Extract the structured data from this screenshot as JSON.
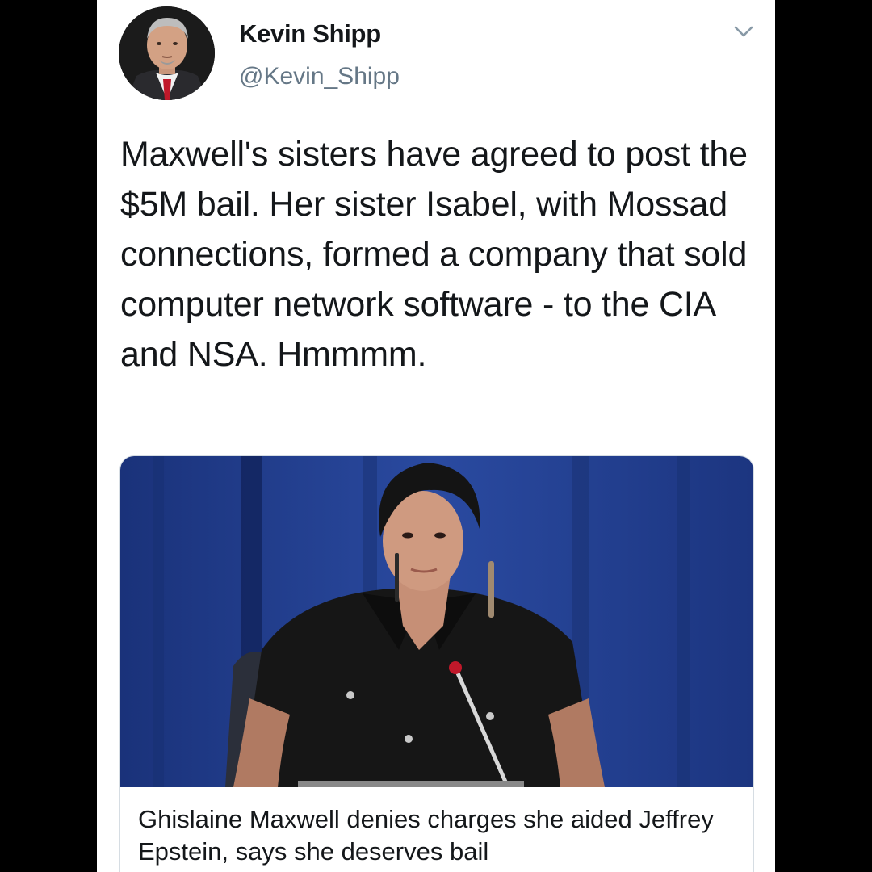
{
  "tweet": {
    "author_name": "Kevin Shipp",
    "author_handle": "@Kevin_Shipp",
    "text": "Maxwell's sisters have agreed to post the $5M bail. Her sister Isabel, with Mossad connections, formed a company that sold computer network software - to the CIA and NSA. Hmmmm.",
    "menu_icon": "chevron-down-icon"
  },
  "card": {
    "title": "Ghislaine Maxwell denies charges she aided Jeffrey Epstein, says she deserves bail"
  },
  "colors": {
    "background": "#000000",
    "tweet_background": "#ffffff",
    "text_primary": "#14171a",
    "text_secondary": "#657786",
    "card_border": "#d6dde3",
    "curtain_blue": "#1f3c8a"
  }
}
